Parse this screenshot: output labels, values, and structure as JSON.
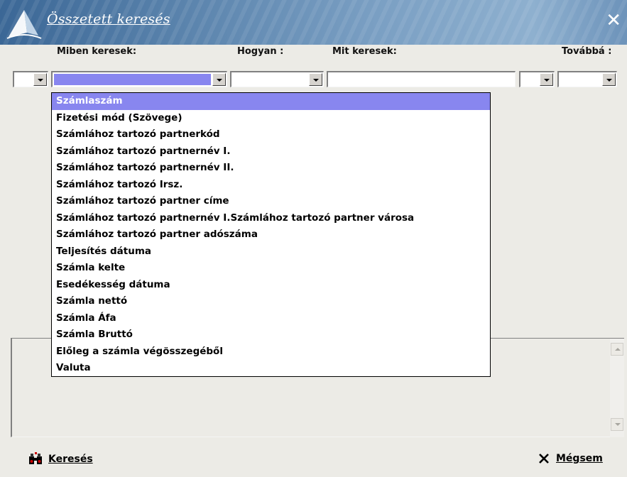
{
  "window": {
    "title": "Összetett keresés"
  },
  "headers": {
    "miben": "Miben keresek:",
    "hogyan": "Hogyan :",
    "mit": "Mit keresek:",
    "tovabba": "Továbbá :"
  },
  "dropdown": {
    "selected_index": 0,
    "items": [
      "Számlaszám",
      "Fizetési mód (Szövege)",
      "Számlához tartozó partnerkód",
      "Számlához tartozó partnernév I.",
      "Számlához tartozó partnernév II.",
      "Számlához tartozó Irsz.",
      "Számlához tartozó partner címe",
      "Számlához tartozó partnernév I.Számlához tartozó partner városa",
      "Számlához tartozó partner adószáma",
      "Teljesítés dátuma",
      "Számla kelte",
      "Esedékesség dátuma",
      "Számla nettó",
      "Számla Áfa",
      "Számla Bruttó",
      "Előleg a számla végösszegéből",
      "Valuta"
    ]
  },
  "buttons": {
    "search_label": "Keresés",
    "cancel_label": "Mégsem"
  },
  "colors": {
    "selection": "#8886ef",
    "title_bar": "#5b84ad"
  }
}
